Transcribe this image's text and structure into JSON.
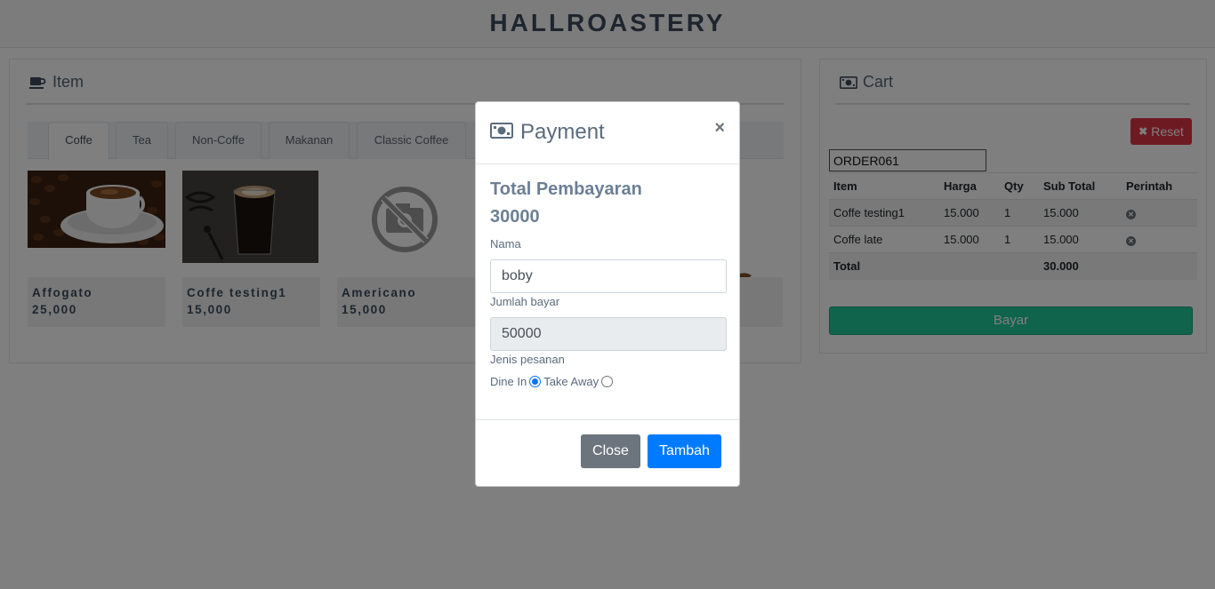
{
  "header": {
    "title": "HALLROASTERY"
  },
  "item_panel": {
    "title": "Item",
    "icon": "coffee-cup-icon",
    "tabs": [
      {
        "label": "Coffe",
        "active": true
      },
      {
        "label": "Tea",
        "active": false
      },
      {
        "label": "Non-Coffe",
        "active": false
      },
      {
        "label": "Makanan",
        "active": false
      },
      {
        "label": "Classic Coffee",
        "active": false
      }
    ],
    "products": [
      {
        "name": "Affogato",
        "price": "25,000",
        "image": "coffee-cup-beans-photo"
      },
      {
        "name": "Coffe testing1",
        "price": "15,000",
        "image": "latte-glass-photo"
      },
      {
        "name": "Americano",
        "price": "15,000",
        "image": "no-photo-icon"
      }
    ]
  },
  "cart_panel": {
    "title": "Cart",
    "icon": "money-icon",
    "reset_label": "Reset",
    "order_id": "ORDER061",
    "columns": [
      "Item",
      "Harga",
      "Qty",
      "Sub Total",
      "Perintah"
    ],
    "rows": [
      {
        "item": "Coffe testing1",
        "harga": "15.000",
        "qty": "1",
        "subtotal": "15.000"
      },
      {
        "item": "Coffe late",
        "harga": "15.000",
        "qty": "1",
        "subtotal": "15.000"
      }
    ],
    "total_label": "Total",
    "total_value": "30.000",
    "pay_label": "Bayar"
  },
  "modal": {
    "title": "Payment",
    "close_symbol": "×",
    "total_label": "Total Pembayaran",
    "total_value": "30000",
    "name_label": "Nama",
    "name_value": "boby",
    "amount_label": "Jumlah bayar",
    "amount_value": "50000",
    "order_type_label": "Jenis pesanan",
    "options": [
      {
        "label": "Dine In",
        "checked": true
      },
      {
        "label": "Take Away",
        "checked": false
      }
    ],
    "close_button": "Close",
    "submit_button": "Tambah"
  },
  "colors": {
    "danger": "#dc3545",
    "success": "#20c997",
    "primary": "#007bff",
    "secondary": "#6c757d"
  }
}
